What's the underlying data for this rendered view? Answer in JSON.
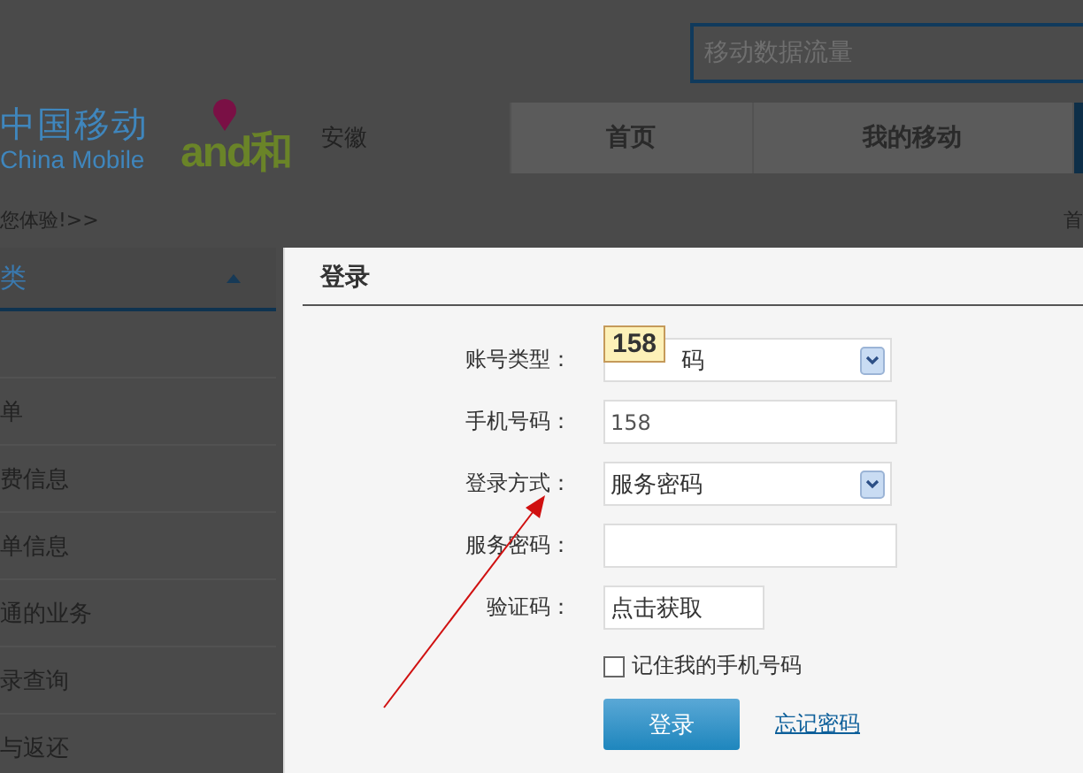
{
  "header": {
    "search": {
      "placeholder": "移动数据流量"
    },
    "logo": {
      "name": "中国移动",
      "english": "China Mobile",
      "brand": "and和"
    },
    "province": "安徽",
    "nav": [
      {
        "label": "首页",
        "selected": false
      },
      {
        "label": "我的移动",
        "selected": false
      },
      {
        "selected": true
      }
    ]
  },
  "breadcrumb": {
    "left": "您体验!>>",
    "right": "首"
  },
  "sidebar": {
    "title": "类",
    "expanded": true,
    "items": [
      "单",
      "费信息",
      "单信息",
      "通的业务",
      "录查询",
      "与返还"
    ]
  },
  "dialog": {
    "title": "登录",
    "fields": [
      {
        "label": "账号类型：",
        "kind": "select",
        "value": "码"
      },
      {
        "label": "手机号码：",
        "kind": "input",
        "value": "158"
      },
      {
        "label": "登录方式：",
        "kind": "select",
        "value": "服务密码"
      },
      {
        "label": "服务密码：",
        "kind": "input"
      },
      {
        "label": "验证码：",
        "kind": "captcha",
        "value": "点击获取"
      }
    ],
    "remember": {
      "label": "记住我的手机号码",
      "checked": false
    },
    "submit": "登录",
    "forgot": "忘记密码",
    "tooltip": "158"
  }
}
